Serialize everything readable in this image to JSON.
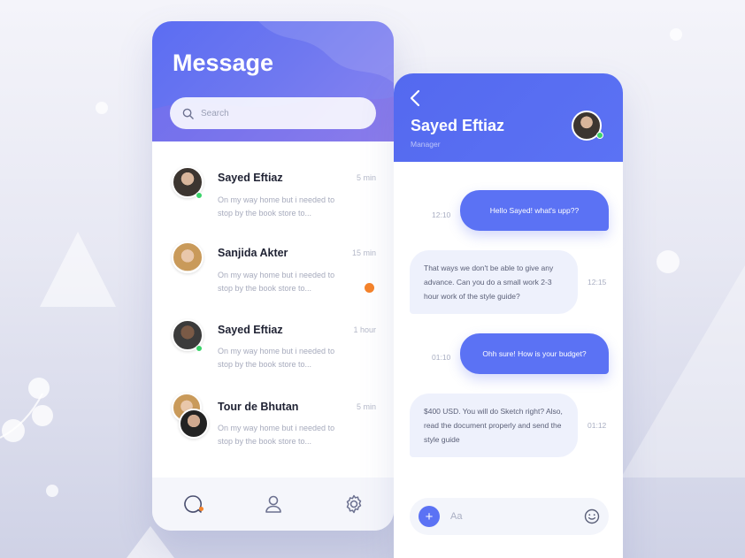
{
  "inbox": {
    "title": "Message",
    "search_placeholder": "Search",
    "conversations": [
      {
        "name": "Sayed Eftiaz",
        "time": "5 min",
        "preview": "On my way home but i needed to stop by the book store to...",
        "online": true,
        "unread": false
      },
      {
        "name": "Sanjida Akter",
        "time": "15 min",
        "preview": "On my way home but i needed to stop by the book store to...",
        "online": false,
        "unread": true
      },
      {
        "name": "Sayed Eftiaz",
        "time": "1 hour",
        "preview": "On my way home but i needed to stop by the book store to...",
        "online": true,
        "unread": false
      },
      {
        "name": "Tour de Bhutan",
        "time": "5 min",
        "preview": "On my way home but i needed to stop by the book store to...",
        "online": false,
        "unread": false
      }
    ],
    "nav": [
      {
        "icon": "chat-icon",
        "active": true
      },
      {
        "icon": "user-icon",
        "active": false
      },
      {
        "icon": "gear-icon",
        "active": false
      }
    ]
  },
  "chat": {
    "contact_name": "Sayed Eftiaz",
    "contact_role": "Manager",
    "input_placeholder": "Aa",
    "messages": [
      {
        "direction": "out",
        "text": "Hello Sayed! what's upp??",
        "time": "12:10"
      },
      {
        "direction": "in",
        "text": "That ways we don't be able to give any advance. Can you do a small work 2-3 hour work of the style guide?",
        "time": "12:15"
      },
      {
        "direction": "out",
        "text": "Ohh sure! How is your budget?",
        "time": "01:10"
      },
      {
        "direction": "in",
        "text": "$400 USD. You will do Sketch right? Also, read the document properly and send the style guide",
        "time": "01:12"
      }
    ]
  },
  "colors": {
    "accent": "#5b72f4",
    "unread": "#f5832a",
    "online": "#3bd36a"
  }
}
